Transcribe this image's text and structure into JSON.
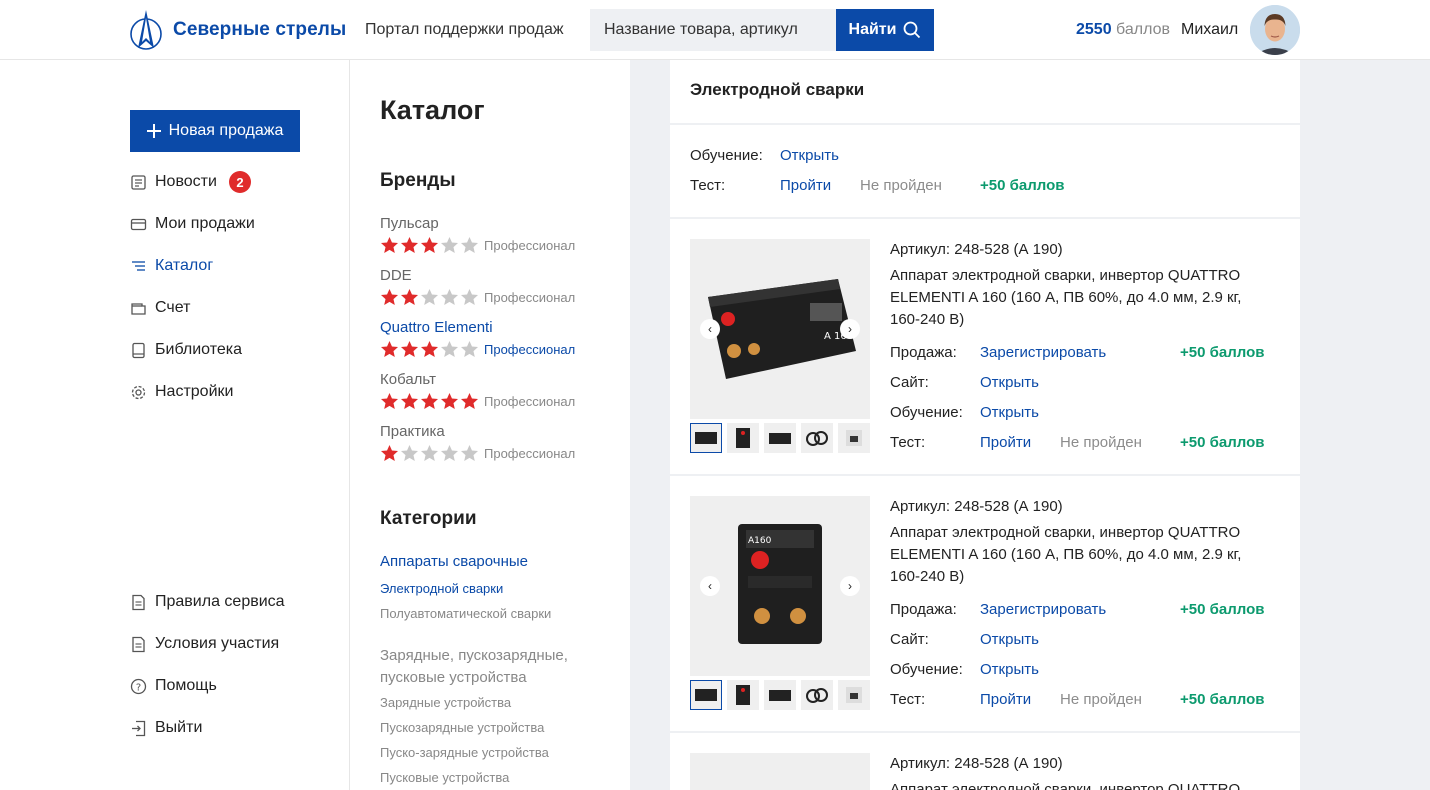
{
  "header": {
    "brand": "Северные стрелы",
    "portal": "Портал поддержки продаж",
    "search_placeholder": "Название товара, артикул",
    "search_button": "Найти",
    "points_value": "2550",
    "points_label": "баллов",
    "user": "Михаил"
  },
  "sidebar": {
    "new_sale": "Новая продажа",
    "items": [
      {
        "label": "Новости",
        "icon": "news-icon",
        "badge": "2"
      },
      {
        "label": "Мои продажи",
        "icon": "card-icon"
      },
      {
        "label": "Каталог",
        "icon": "list-icon"
      },
      {
        "label": "Счет",
        "icon": "wallet-icon"
      },
      {
        "label": "Библиотека",
        "icon": "book-icon"
      },
      {
        "label": "Настройки",
        "icon": "gear-icon"
      }
    ],
    "bottom": [
      {
        "label": "Правила сервиса",
        "icon": "document-icon"
      },
      {
        "label": "Условия участия",
        "icon": "document-icon"
      },
      {
        "label": "Помощь",
        "icon": "help-icon"
      },
      {
        "label": "Выйти",
        "icon": "logout-icon"
      }
    ]
  },
  "catalog": {
    "title": "Каталог",
    "brands_title": "Бренды",
    "brands": [
      {
        "name": "Пульсар",
        "stars": 3,
        "level": "Профессионал"
      },
      {
        "name": "DDE",
        "stars": 2,
        "level": "Профессионал"
      },
      {
        "name": "Quattro Elementi",
        "stars": 3,
        "level": "Профессионал"
      },
      {
        "name": "Кобальт",
        "stars": 5,
        "level": "Профессионал"
      },
      {
        "name": "Практика",
        "stars": 1,
        "level": "Профессионал"
      }
    ],
    "categories_title": "Категории",
    "categories": {
      "group1": "Аппараты сварочные",
      "sub1": "Электродной сварки",
      "sub2": "Полуавтоматической сварки",
      "group2": "Зарядные, пускозарядные, пусковые устройства",
      "sub3": "Зарядные устройства",
      "sub4": "Пускозарядные устройства",
      "sub5": "Пуско-зарядные устройства",
      "sub6": "Пусковые устройства"
    }
  },
  "panel": {
    "title": "Электродной сварки",
    "training_label": "Обучение:",
    "training_link": "Открыть",
    "test_label": "Тест:",
    "test_link": "Пройти",
    "test_status": "Не пройден",
    "test_points": "+50 баллов",
    "products": [
      {
        "article_label": "Артикул:",
        "article": "248-528 (А 190)",
        "name": "Аппарат электродной сварки, инвертор QUATTRO ELEMENTI A 160 (160 А, ПВ 60%, до 4.0 мм, 2.9 кг, 160-240 В)",
        "sale_label": "Продажа:",
        "sale_link": "Зарегистрировать",
        "sale_points": "+50 баллов",
        "site_label": "Сайт:",
        "site_link": "Открыть",
        "training_label": "Обучение:",
        "training_link": "Открыть",
        "test_label": "Тест:",
        "test_link": "Пройти",
        "test_status": "Не пройден",
        "test_points": "+50 баллов"
      },
      {
        "article_label": "Артикул:",
        "article": "248-528 (А 190)",
        "name": "Аппарат электродной сварки, инвертор QUATTRO ELEMENTI A 160 (160 А, ПВ 60%, до 4.0 мм, 2.9 кг, 160-240 В)",
        "sale_label": "Продажа:",
        "sale_link": "Зарегистрировать",
        "sale_points": "+50 баллов",
        "site_label": "Сайт:",
        "site_link": "Открыть",
        "training_label": "Обучение:",
        "training_link": "Открыть",
        "test_label": "Тест:",
        "test_link": "Пройти",
        "test_status": "Не пройден",
        "test_points": "+50 баллов"
      },
      {
        "article_label": "Артикул:",
        "article": "248-528 (А 190)",
        "name": "Аппарат электродной сварки, инвертор QUATTRO"
      }
    ]
  },
  "colors": {
    "accent": "#0b4aa8",
    "green": "#0c9a6e",
    "badge": "#e02b2b",
    "star": "#e02b2b"
  }
}
